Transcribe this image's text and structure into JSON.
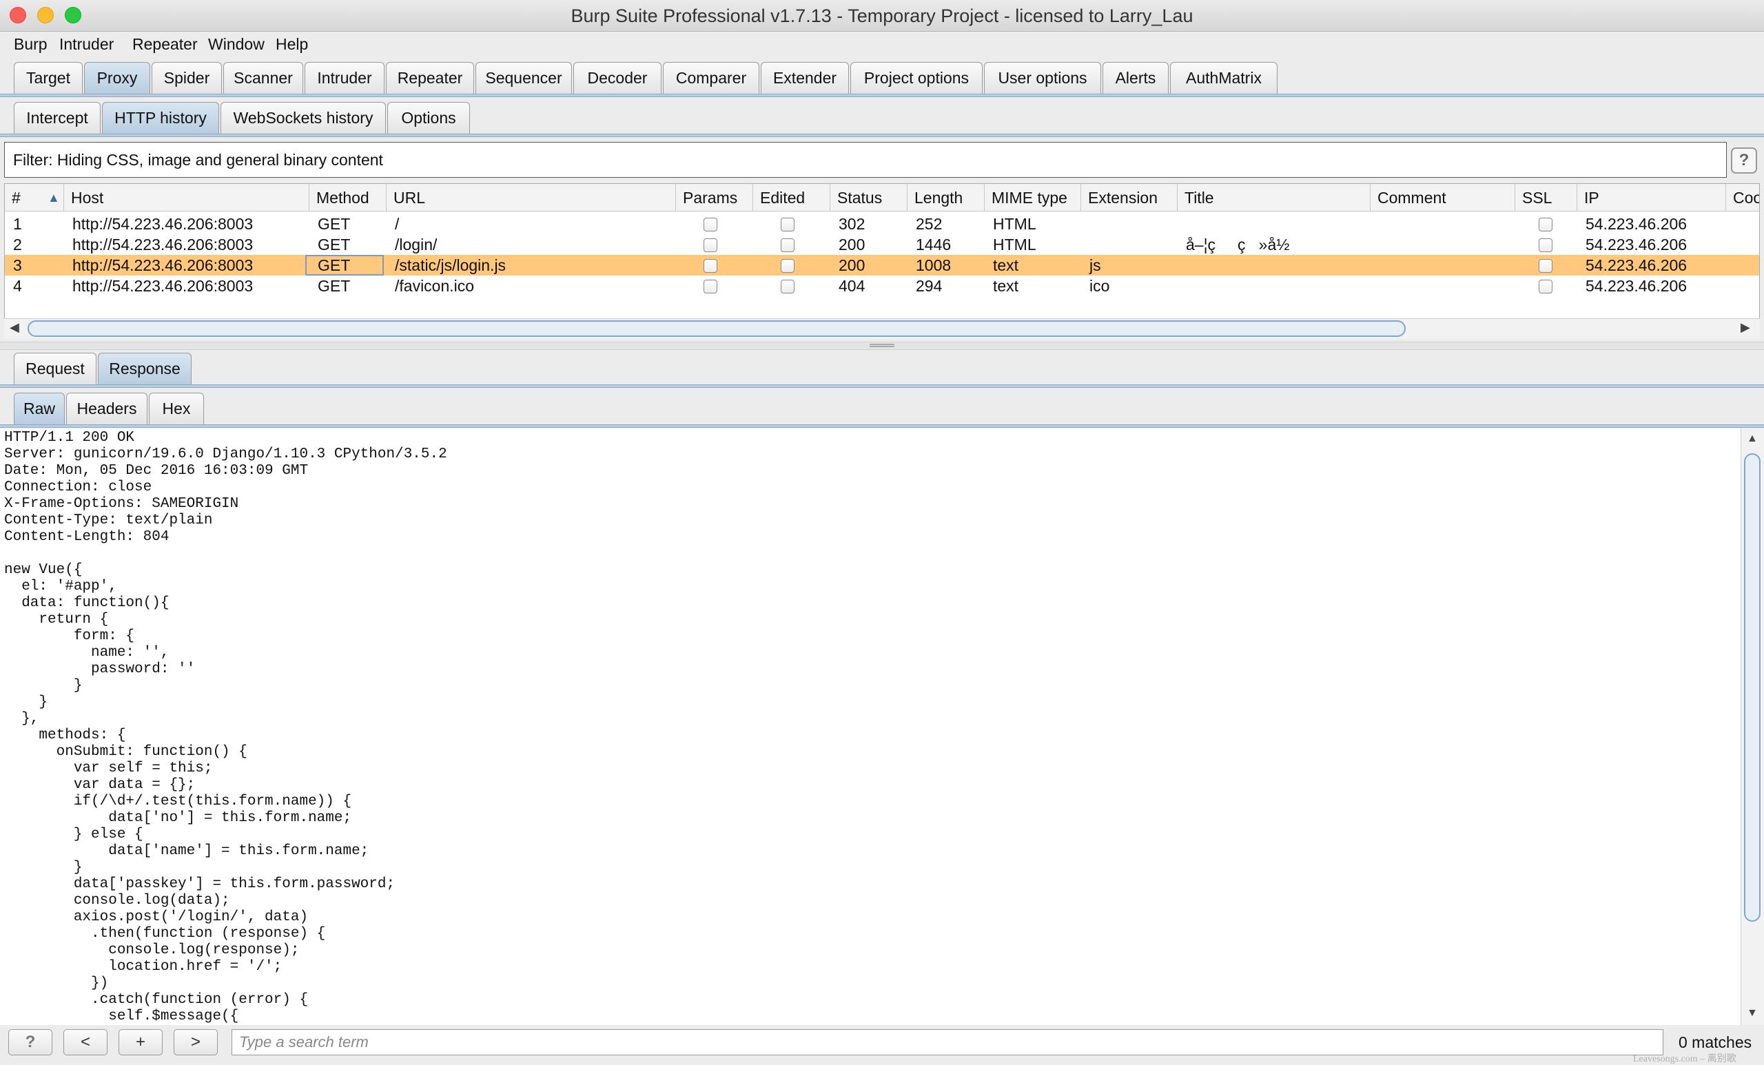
{
  "window": {
    "title": "Burp Suite Professional v1.7.13 - Temporary Project - licensed to Larry_Lau"
  },
  "menu": [
    "Burp",
    "Intruder",
    "Repeater",
    "Window",
    "Help"
  ],
  "main_tabs": [
    "Target",
    "Proxy",
    "Spider",
    "Scanner",
    "Intruder",
    "Repeater",
    "Sequencer",
    "Decoder",
    "Comparer",
    "Extender",
    "Project options",
    "User options",
    "Alerts",
    "AuthMatrix"
  ],
  "main_tab_selected": "Proxy",
  "proxy_tabs": [
    "Intercept",
    "HTTP history",
    "WebSockets history",
    "Options"
  ],
  "proxy_tab_selected": "HTTP history",
  "filter": {
    "text": "Filter:  Hiding CSS, image and general binary content",
    "help": "?"
  },
  "table": {
    "columns": [
      "#",
      "Host",
      "Method",
      "URL",
      "Params",
      "Edited",
      "Status",
      "Length",
      "MIME type",
      "Extension",
      "Title",
      "Comment",
      "SSL",
      "IP",
      "Coo"
    ],
    "sort_indicator": "▲",
    "rows": [
      {
        "num": "1",
        "host": "http://54.223.46.206:8003",
        "method": "GET",
        "url": "/",
        "status": "302",
        "length": "252",
        "mime": "HTML",
        "ext": "",
        "title": "",
        "comment": "",
        "ip": "54.223.46.206"
      },
      {
        "num": "2",
        "host": "http://54.223.46.206:8003",
        "method": "GET",
        "url": "/login/",
        "status": "200",
        "length": "1446",
        "mime": "HTML",
        "ext": "",
        "title": "å–¦ç     ç   »å½",
        "comment": "",
        "ip": "54.223.46.206"
      },
      {
        "num": "3",
        "host": "http://54.223.46.206:8003",
        "method": "GET",
        "url": "/static/js/login.js",
        "status": "200",
        "length": "1008",
        "mime": "text",
        "ext": "js",
        "title": "",
        "comment": "",
        "ip": "54.223.46.206"
      },
      {
        "num": "4",
        "host": "http://54.223.46.206:8003",
        "method": "GET",
        "url": "/favicon.ico",
        "status": "404",
        "length": "294",
        "mime": "text",
        "ext": "ico",
        "title": "",
        "comment": "",
        "ip": "54.223.46.206"
      }
    ],
    "selected_row": "3"
  },
  "message_tabs": [
    "Request",
    "Response"
  ],
  "message_tab_selected": "Response",
  "view_tabs": [
    "Raw",
    "Headers",
    "Hex"
  ],
  "view_tab_selected": "Raw",
  "response_text": "HTTP/1.1 200 OK\nServer: gunicorn/19.6.0 Django/1.10.3 CPython/3.5.2\nDate: Mon, 05 Dec 2016 16:03:09 GMT\nConnection: close\nX-Frame-Options: SAMEORIGIN\nContent-Type: text/plain\nContent-Length: 804\n\nnew Vue({\n  el: '#app',\n  data: function(){\n    return {\n        form: {\n          name: '',\n          password: ''\n        }\n    }\n  },\n    methods: {\n      onSubmit: function() {\n        var self = this;\n        var data = {};\n        if(/\\d+/.test(this.form.name)) {\n            data['no'] = this.form.name;\n        } else {\n            data['name'] = this.form.name;\n        }\n        data['passkey'] = this.form.password;\n        console.log(data);\n        axios.post('/login/', data)\n          .then(function (response) {\n            console.log(response);\n            location.href = '/';\n          })\n          .catch(function (error) {\n            self.$message({",
  "bottom": {
    "help": "?",
    "prev": "<",
    "add": "+",
    "next": ">",
    "search_placeholder": "Type a search term",
    "matches": "0 matches"
  },
  "watermark": "Leavesongs.com – 离别歌"
}
